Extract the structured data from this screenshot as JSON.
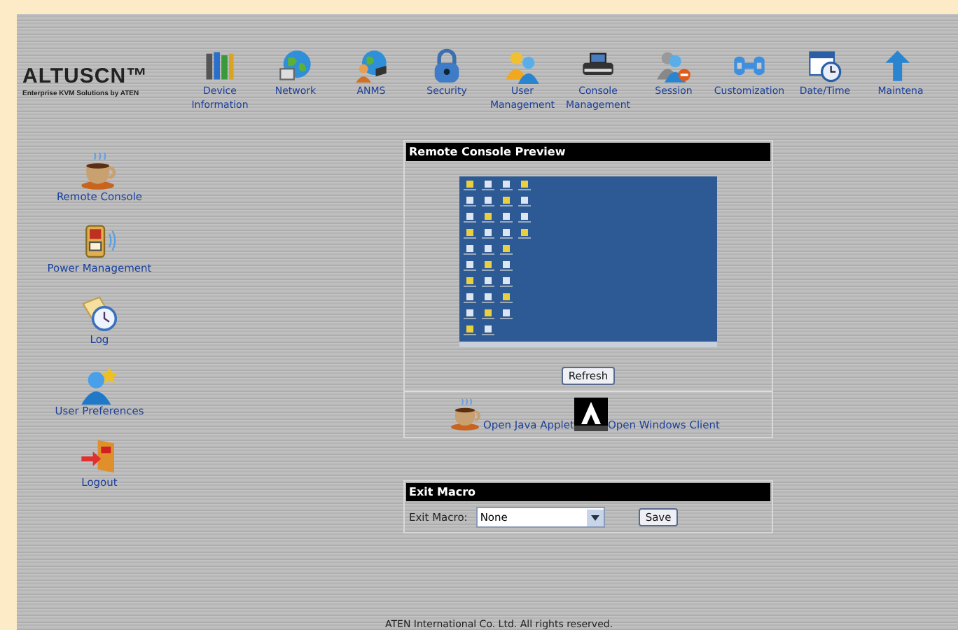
{
  "logo": {
    "name": "ALTUSCN™",
    "tagline": "Enterprise KVM Solutions by ATEN"
  },
  "nav": [
    {
      "label": "Device Information",
      "kind": "books"
    },
    {
      "label": "Network",
      "kind": "globe"
    },
    {
      "label": "ANMS",
      "kind": "globe-user"
    },
    {
      "label": "Security",
      "kind": "lock"
    },
    {
      "label": "User Management",
      "kind": "users"
    },
    {
      "label": "Console Management",
      "kind": "device"
    },
    {
      "label": "Session",
      "kind": "user-minus"
    },
    {
      "label": "Customization",
      "kind": "wrench"
    },
    {
      "label": "Date/Time",
      "kind": "calendar"
    },
    {
      "label": "Maintena",
      "kind": "arrow"
    }
  ],
  "sidebar": [
    {
      "label": "Remote Console",
      "kind": "cup"
    },
    {
      "label": "Power Management",
      "kind": "power"
    },
    {
      "label": "Log",
      "kind": "log"
    },
    {
      "label": "User Preferences",
      "kind": "user-star"
    },
    {
      "label": "Logout",
      "kind": "exit"
    }
  ],
  "preview_panel": {
    "title": "Remote Console Preview",
    "refresh_button": "Refresh",
    "links": [
      {
        "label": "Open Java Applet",
        "kind": "cup"
      },
      {
        "label": "Open Windows Client",
        "kind": "aten"
      }
    ]
  },
  "exit_macro_panel": {
    "title": "Exit Macro",
    "field_label": "Exit Macro:",
    "value": "None",
    "save_button": "Save"
  },
  "footer": "ATEN International Co. Ltd. All rights reserved."
}
